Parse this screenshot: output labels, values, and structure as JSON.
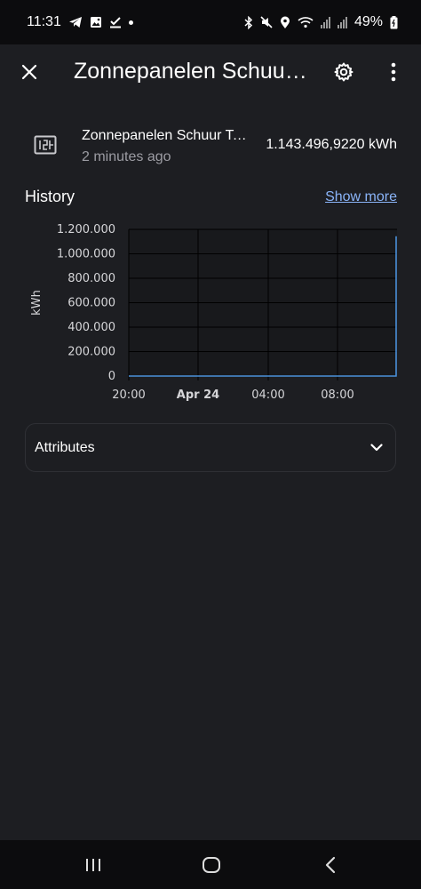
{
  "status_bar": {
    "time": "11:31",
    "battery": "49%",
    "left_icons": [
      "telegram-icon",
      "gallery-icon",
      "download-check-icon",
      "dot"
    ],
    "right_icons": [
      "bluetooth-icon",
      "mute-icon",
      "location-icon",
      "wifi-icon",
      "signal-icon",
      "signal-icon",
      "battery-icon"
    ]
  },
  "app_bar": {
    "title": "Zonnepanelen Schuur Totaal",
    "close_icon": "close-icon",
    "settings_icon": "gear-icon",
    "more_icon": "more-vert-icon"
  },
  "entity": {
    "name": "Zonnepanelen Schuur Totaal",
    "last_changed": "2 minutes ago",
    "value": "1.143.496,9220 kWh",
    "icon": "solar-panel-icon"
  },
  "history": {
    "title": "History",
    "show_more": "Show more"
  },
  "chart_data": {
    "type": "line",
    "ylabel": "kWh",
    "xlabel": "",
    "y_ticks": [
      "1.200.000",
      "1.000.000",
      "800.000",
      "600.000",
      "400.000",
      "200.000",
      "0"
    ],
    "ylim": [
      0,
      1200000
    ],
    "x_ticks": [
      "20:00",
      "Apr 24",
      "04:00",
      "08:00"
    ],
    "grid": true,
    "series": [
      {
        "x": [
          "20:00",
          "08:00",
          "~10:00",
          "~10:00"
        ],
        "values": [
          0,
          0,
          0,
          1143497
        ],
        "color": "#4a90d9"
      }
    ]
  },
  "attributes": {
    "label": "Attributes",
    "icon": "chevron-down-icon"
  },
  "nav_bar": {
    "recents_icon": "recents-icon",
    "home_icon": "home-icon",
    "back_icon": "back-icon"
  },
  "colors": {
    "background": "#1d1e22",
    "link": "#8ab4f8",
    "series": "#4a90d9"
  }
}
